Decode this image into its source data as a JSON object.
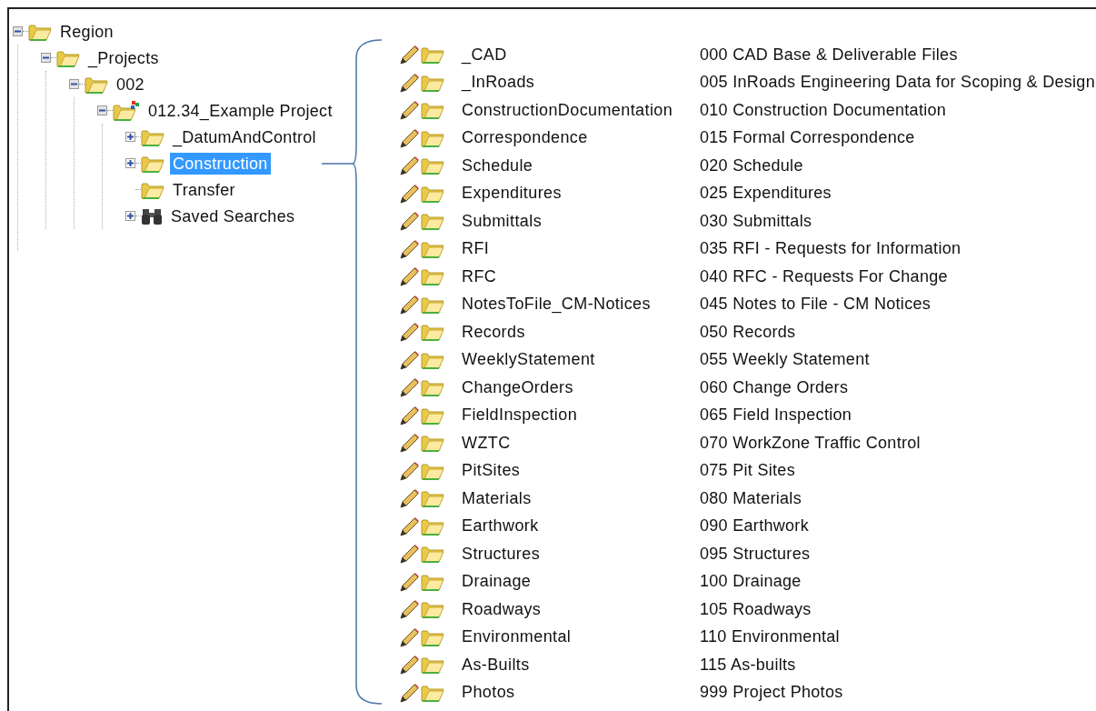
{
  "tree": [
    {
      "label": "Region",
      "kind": "folder",
      "expanded": true,
      "selected": false,
      "children": [
        {
          "label": "_Projects",
          "kind": "folder",
          "expanded": true,
          "selected": false,
          "children": [
            {
              "label": "002",
              "kind": "folder",
              "expanded": true,
              "selected": false,
              "children": [
                {
                  "label": "012.34_Example Project",
                  "kind": "project",
                  "expanded": true,
                  "selected": false,
                  "children": [
                    {
                      "label": "_DatumAndControl",
                      "kind": "folder",
                      "expanded": false,
                      "selected": false
                    },
                    {
                      "label": "Construction",
                      "kind": "folder",
                      "expanded": false,
                      "selected": true
                    },
                    {
                      "label": "Transfer",
                      "kind": "folder",
                      "selected": false
                    },
                    {
                      "label": "Saved Searches",
                      "kind": "search",
                      "expanded": false,
                      "selected": false
                    }
                  ]
                }
              ]
            }
          ]
        }
      ]
    }
  ],
  "subfolders": [
    {
      "name": "_CAD",
      "description": "000 CAD Base & Deliverable Files"
    },
    {
      "name": "_InRoads",
      "description": "005 InRoads Engineering Data for Scoping & Design"
    },
    {
      "name": "ConstructionDocumentation",
      "description": "010 Construction Documentation"
    },
    {
      "name": "Correspondence",
      "description": "015 Formal Correspondence"
    },
    {
      "name": "Schedule",
      "description": "020 Schedule"
    },
    {
      "name": "Expenditures",
      "description": "025 Expenditures"
    },
    {
      "name": "Submittals",
      "description": "030 Submittals"
    },
    {
      "name": "RFI",
      "description": "035 RFI - Requests for Information"
    },
    {
      "name": "RFC",
      "description": "040 RFC - Requests For Change"
    },
    {
      "name": "NotesToFile_CM-Notices",
      "description": "045 Notes to File - CM Notices"
    },
    {
      "name": "Records",
      "description": "050 Records"
    },
    {
      "name": "WeeklyStatement",
      "description": "055 Weekly Statement"
    },
    {
      "name": "ChangeOrders",
      "description": "060 Change Orders"
    },
    {
      "name": "FieldInspection",
      "description": "065 Field Inspection"
    },
    {
      "name": "WZTC",
      "description": "070 WorkZone Traffic Control"
    },
    {
      "name": "PitSites",
      "description": "075 Pit Sites"
    },
    {
      "name": "Materials",
      "description": "080 Materials"
    },
    {
      "name": "Earthwork",
      "description": "090 Earthwork"
    },
    {
      "name": "Structures",
      "description": "095 Structures"
    },
    {
      "name": "Drainage",
      "description": "100 Drainage"
    },
    {
      "name": "Roadways",
      "description": "105 Roadways"
    },
    {
      "name": "Environmental",
      "description": "110 Environmental"
    },
    {
      "name": "As-Builts",
      "description": "115 As-builts"
    },
    {
      "name": "Photos",
      "description": "999 Project Photos"
    }
  ]
}
